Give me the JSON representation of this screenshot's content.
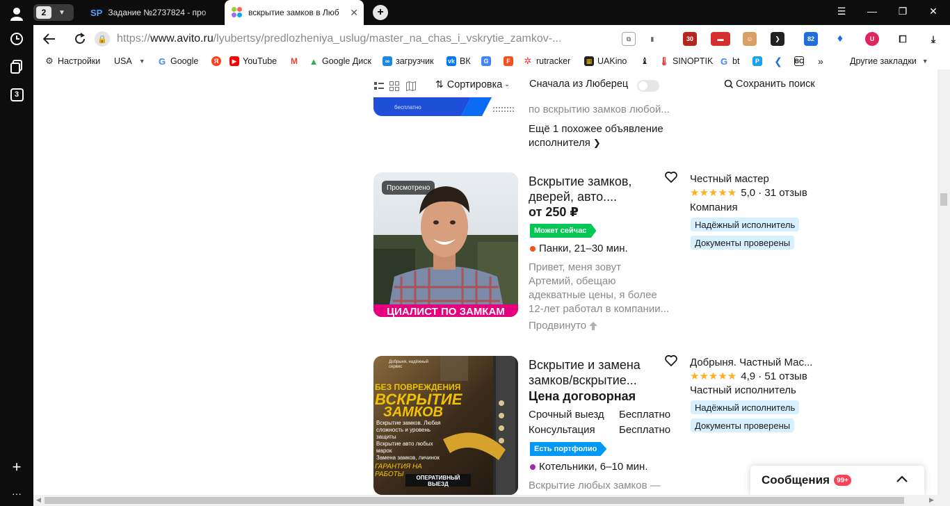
{
  "browser": {
    "tab_count": "2",
    "sidebar_counter": "3",
    "tabs": [
      {
        "title": "Задание №2737824 - про",
        "favicon": "SP"
      },
      {
        "title": "вскрытие замков в Люб"
      }
    ],
    "url_scheme": "https://",
    "url_host": "www.avito.ru",
    "url_path": "/lyubertsy/predlozheniya_uslug/master_na_chas_i_vskrytie_zamkov-...",
    "extensions": [
      "30",
      "82"
    ],
    "bookmarks": [
      "Настройки",
      "USA",
      "Google",
      "YouTube",
      "Google Диск",
      "загрузчик",
      "ВК",
      "rutracker",
      "UAKino",
      "SINOPTIK",
      "bt",
      "Другие закладки"
    ]
  },
  "toolbar": {
    "sort_label": "Сортировка",
    "lubertsy_first": "Сначала из Люберец",
    "save_search": "Сохранить поиск"
  },
  "prev_listing": {
    "banner_text": "бесплатно",
    "desc_tail": "по вскрытию замков любой...",
    "more_line1": "Ещё 1 похожее объявление",
    "more_line2": "исполнителя"
  },
  "listings": [
    {
      "seen_label": "Просмотрено",
      "photo_caption": "ЦИАЛИСТ ПО ЗАМКАМ",
      "title_line1": "Вскрытие замков,",
      "title_line2": "дверей, авто....",
      "price": "от 250 ₽",
      "badge": "Может сейчас",
      "location": "Панки, 21–30 мин.",
      "location_dot": "#f4511e",
      "desc": [
        "Привет, меня зовут",
        "Артемий, обещаю",
        "адекватные цены, я более",
        "12-лет работал в компании..."
      ],
      "promoted": "Продвинуто",
      "seller_name": "Честный мастер",
      "stars": "★★★★★",
      "rating": "5,0 · 31 отзыв",
      "seller_type": "Компания",
      "pills": [
        "Надёжный исполнитель",
        "Документы проверены"
      ]
    },
    {
      "photo_brand": "Добрыня, надёжный сервис",
      "photo_line1": "БЕЗ ПОВРЕЖДЕНИЯ",
      "photo_line2": "ВСКРЫТИЕ",
      "photo_line3": "ЗАМКОВ",
      "photo_bullets": [
        "Вскрытие замков. Любая",
        "сложность и уровень",
        "защиты",
        "Вскрытие авто любых",
        "марок",
        "Замена замков, личинок"
      ],
      "photo_guarantee": "ГАРАНТИЯ НА РАБОТЫ",
      "photo_button": "ОПЕРАТИВНЫЙ ВЫЕЗД",
      "title_line1": "Вскрытие и замена",
      "title_line2": "замков/вскрытие...",
      "price": "Цена договорная",
      "services": [
        {
          "name": "Срочный выезд",
          "value": "Бесплатно"
        },
        {
          "name": "Консультация",
          "value": "Бесплатно"
        }
      ],
      "badge": "Есть портфолио",
      "location": "Котельники, 6–10 мин.",
      "location_dot": "#9c27b0",
      "desc": [
        "Вскрытие любых замков —"
      ],
      "seller_name": "Добрыня. Частный Мас...",
      "stars": "★★★★★",
      "rating": "4,9 · 51 отзыв",
      "seller_type": "Частный исполнитель",
      "pills": [
        "Надёжный исполнитель",
        "Документы проверены"
      ]
    }
  ],
  "messages": {
    "title": "Сообщения",
    "count": "99+"
  }
}
